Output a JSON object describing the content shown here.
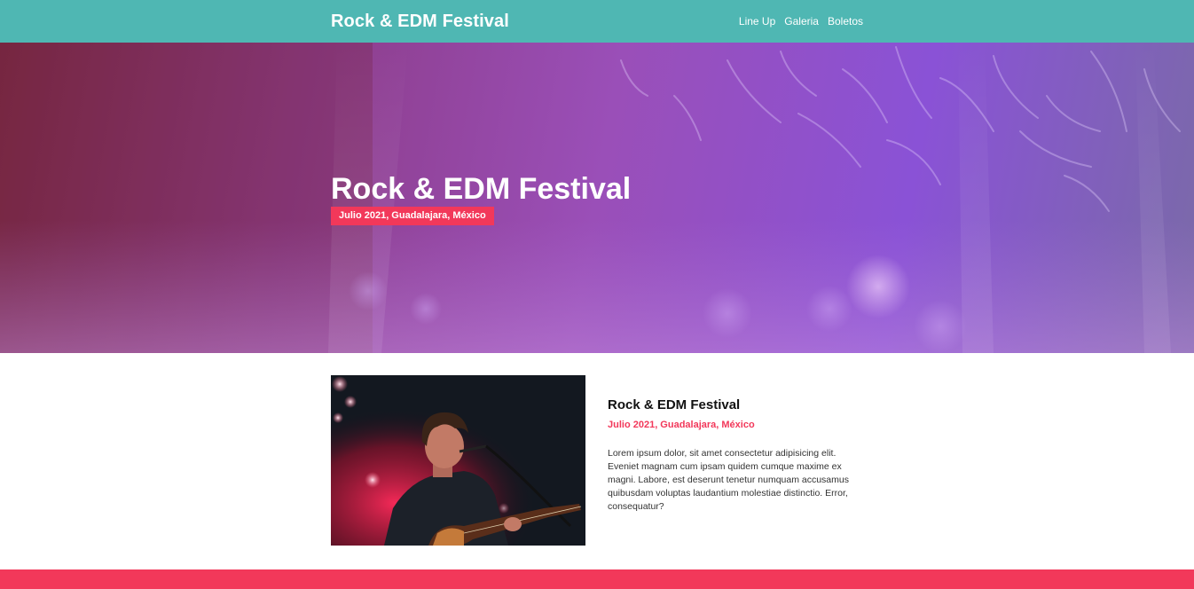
{
  "header": {
    "brand": "Rock & EDM Festival",
    "nav": [
      "Line Up",
      "Galeria",
      "Boletos"
    ]
  },
  "hero": {
    "title": "Rock & EDM Festival",
    "badge": "Julio 2021, Guadalajara, México"
  },
  "about": {
    "title": "Rock & EDM Festival",
    "date": "Julio 2021, Guadalajara, México",
    "text": "Lorem ipsum dolor, sit amet consectetur adipisicing elit. Eveniet magnam cum ipsam quidem cumque maxime ex magni. Labore, est deserunt tenetur numquam accusamus quibusdam voluptas laudantium molestiae distinctio. Error, consequatur?"
  },
  "colors": {
    "header_bg": "#4fb7b3",
    "accent": "#f2385a",
    "hero_purple": "#9a4fb8"
  },
  "icons": {
    "hero_image": "concert-crowd-image",
    "photo": "guitarist-singer-photo"
  }
}
